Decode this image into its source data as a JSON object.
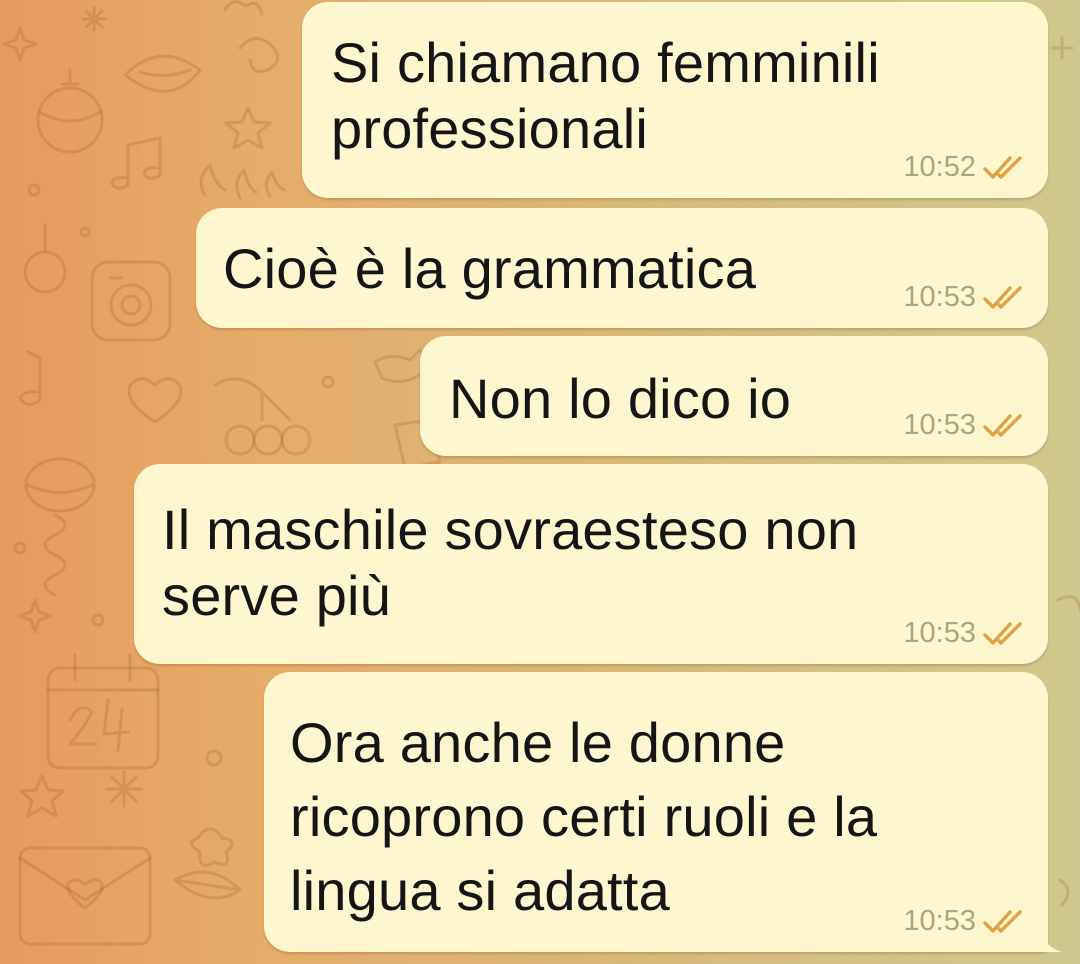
{
  "chat": {
    "messages": [
      {
        "text": "Si chiamano femminili\nprofessionali",
        "time": "10:52",
        "status_icon": "double-check-icon"
      },
      {
        "text": "Cioè è la grammatica",
        "time": "10:53",
        "status_icon": "double-check-icon"
      },
      {
        "text": "Non lo dico io",
        "time": "10:53",
        "status_icon": "double-check-icon"
      },
      {
        "text": "Il maschile sovraesteso non\nserve più",
        "time": "10:53",
        "status_icon": "double-check-icon"
      },
      {
        "text": "Ora anche le donne\nricoprono certi ruoli e la\nlingua si adatta",
        "time": "10:53",
        "status_icon": "double-check-icon"
      }
    ]
  },
  "colors": {
    "bubble_background": "#fdf6cf",
    "time_text": "#a8a487",
    "check_marks": "#e2a042",
    "wallpaper_left": "#e89a5e",
    "wallpaper_right": "#cfc88c"
  }
}
